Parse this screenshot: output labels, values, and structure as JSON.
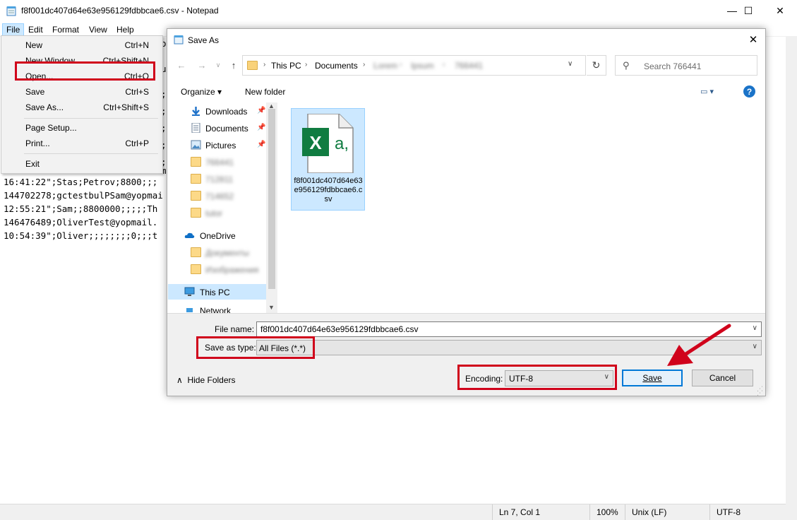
{
  "window": {
    "title": "f8f001dc407d64e63e956129fdbbcae6.csv - Notepad",
    "minimize_glyph": "—",
    "maximize_glyph": "☐",
    "close_glyph": "✕"
  },
  "menubar": [
    "File",
    "Edit",
    "Format",
    "View",
    "Help"
  ],
  "file_menu": {
    "items": [
      {
        "label": "New",
        "shortcut": "Ctrl+N"
      },
      {
        "label": "New Window",
        "shortcut": "Ctrl+Shift+N"
      },
      {
        "label": "Open...",
        "shortcut": "Ctrl+O"
      },
      {
        "label": "Save",
        "shortcut": "Ctrl+S"
      },
      {
        "label": "Save As...",
        "shortcut": "Ctrl+Shift+S"
      },
      {
        "label": "Page Setup...",
        "shortcut": ""
      },
      {
        "label": "Print...",
        "shortcut": "Ctrl+P"
      },
      {
        "label": "Exit",
        "shortcut": ""
      }
    ]
  },
  "editor": {
    "visible_lines": [
      "16:41:22\";Stas;Petrov;8800;;;",
      "144702278;gctestbulPSam@yopmai",
      "12:55:21\";Sam;;8800000;;;;;Th",
      "146476489;OliverTest@yopmail.",
      "10:54:39\";Oliver;;;;;;;;0;;;t"
    ],
    "peek_fragments": [
      "o",
      "u",
      ";",
      ";",
      ";",
      ";",
      ";",
      "m"
    ]
  },
  "statusbar": {
    "position": "Ln 7, Col 1",
    "zoom": "100%",
    "line_endings": "Unix (LF)",
    "encoding": "UTF-8"
  },
  "dialog": {
    "title": "Save As",
    "close_glyph": "✕",
    "address": {
      "segments": [
        "This PC",
        "Documents"
      ],
      "blurred_segments": [
        "Lorem",
        "Ipsum",
        "766441"
      ],
      "refresh_glyph": "↻"
    },
    "search_placeholder": "Search 766441",
    "toolbar": {
      "organize": "Organize ▾",
      "new_folder": "New folder",
      "help": "?"
    },
    "nav_items": [
      {
        "label": "Downloads",
        "pinned": true,
        "icon": "download-icon"
      },
      {
        "label": "Documents",
        "pinned": true,
        "icon": "documents-icon"
      },
      {
        "label": "Pictures",
        "pinned": true,
        "icon": "pictures-icon"
      },
      {
        "label": "766441",
        "blurred": true,
        "icon": "folder-icon"
      },
      {
        "label": "712811",
        "blurred": true,
        "icon": "folder-icon"
      },
      {
        "label": "714652",
        "blurred": true,
        "icon": "folder-icon"
      },
      {
        "label": "tutor",
        "blurred": true,
        "icon": "folder-icon"
      },
      {
        "label": "OneDrive",
        "icon": "onedrive-icon"
      },
      {
        "label": "Документы",
        "blurred": true,
        "icon": "folder-icon"
      },
      {
        "label": "Изображения",
        "blurred": true,
        "icon": "folder-icon"
      },
      {
        "label": "This PC",
        "selected": true,
        "icon": "computer-icon"
      },
      {
        "label": "Network",
        "icon": "network-icon"
      }
    ],
    "file_item": {
      "name": "f8f001dc407d64e63e956129fdbbcae6.csv",
      "icon_letter": "X",
      "icon_suffix": "a,"
    },
    "file_name_label": "File name:",
    "file_name_value": "f8f001dc407d64e63e956129fdbbcae6.csv",
    "save_as_type_label": "Save as type:",
    "save_as_type_value": "All Files  (*.*)",
    "hide_folders": "Hide Folders",
    "encoding_label": "Encoding:",
    "encoding_value": "UTF-8",
    "save_button": "Save",
    "cancel_button": "Cancel"
  },
  "colors": {
    "annotation_red": "#d0021b",
    "selection_blue": "#cce8ff",
    "excel_green": "#107c41",
    "default_button_border": "#0078d7"
  }
}
